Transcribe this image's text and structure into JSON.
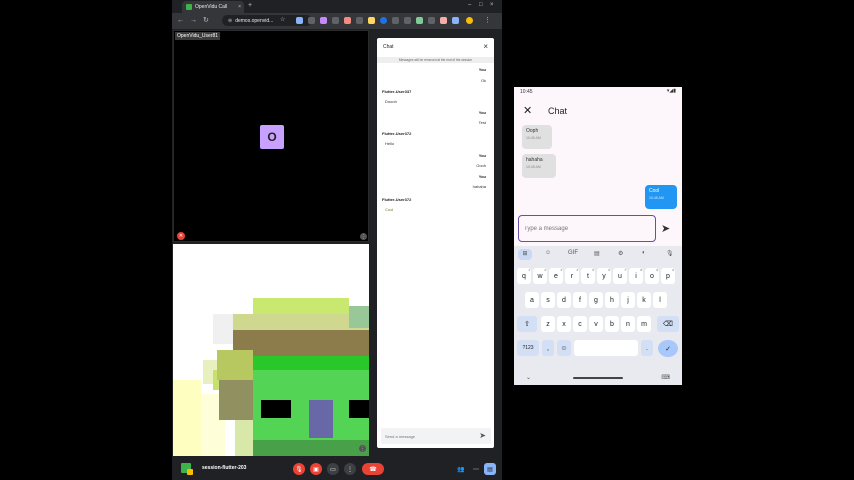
{
  "browser": {
    "tab_title": "OpenVidu Call",
    "tab_close": "×",
    "new_tab": "+",
    "url": "demos.openvid...",
    "window_controls": [
      "–",
      "□",
      "×"
    ]
  },
  "video": {
    "participant_name": "OpenVidu_User81",
    "avatar_letter": "O"
  },
  "chat": {
    "title": "Chat",
    "close": "×",
    "notice": "Messages will be removed at the end of the session",
    "input_placeholder": "Send a message",
    "messages": [
      {
        "from": "You",
        "text": "Ok"
      },
      {
        "from": "Flutter-User337",
        "text": "Doooh"
      },
      {
        "from": "You",
        "text": "Test"
      },
      {
        "from": "Flutter-User372",
        "text": "Hello"
      },
      {
        "from": "You",
        "text": "Oooh"
      },
      {
        "from": "You",
        "text": "hahaha"
      },
      {
        "from": "Flutter-User372",
        "text": "Cool"
      }
    ]
  },
  "call_toolbar": {
    "session_name": "session-flutter-203"
  },
  "phone": {
    "time": "10:45",
    "title": "Chat",
    "close": "✕",
    "bubbles": [
      {
        "text": "Ooph",
        "time": "10:45 AM",
        "dir": "in"
      },
      {
        "text": "hahaha",
        "time": "10:45 AM",
        "dir": "in"
      },
      {
        "text": "Cool",
        "time": "10:45 AM",
        "dir": "out"
      }
    ],
    "input_placeholder": "Type a message",
    "keyboard": {
      "suggest": [
        "GIF"
      ],
      "row1": [
        "q",
        "w",
        "e",
        "r",
        "t",
        "y",
        "u",
        "i",
        "o",
        "p"
      ],
      "row1_sup": [
        "1",
        "2",
        "3",
        "4",
        "5",
        "6",
        "7",
        "8",
        "9",
        "0"
      ],
      "row2": [
        "a",
        "s",
        "d",
        "f",
        "g",
        "h",
        "j",
        "k",
        "l"
      ],
      "row3": [
        "z",
        "x",
        "c",
        "v",
        "b",
        "n",
        "m"
      ],
      "numbers_key": "?123",
      "comma": ",",
      "period": "."
    }
  },
  "colors": {
    "accent_red": "#ea4335",
    "phone_bubble_out": "#2196f3",
    "avatar": "#c8a0ff"
  }
}
